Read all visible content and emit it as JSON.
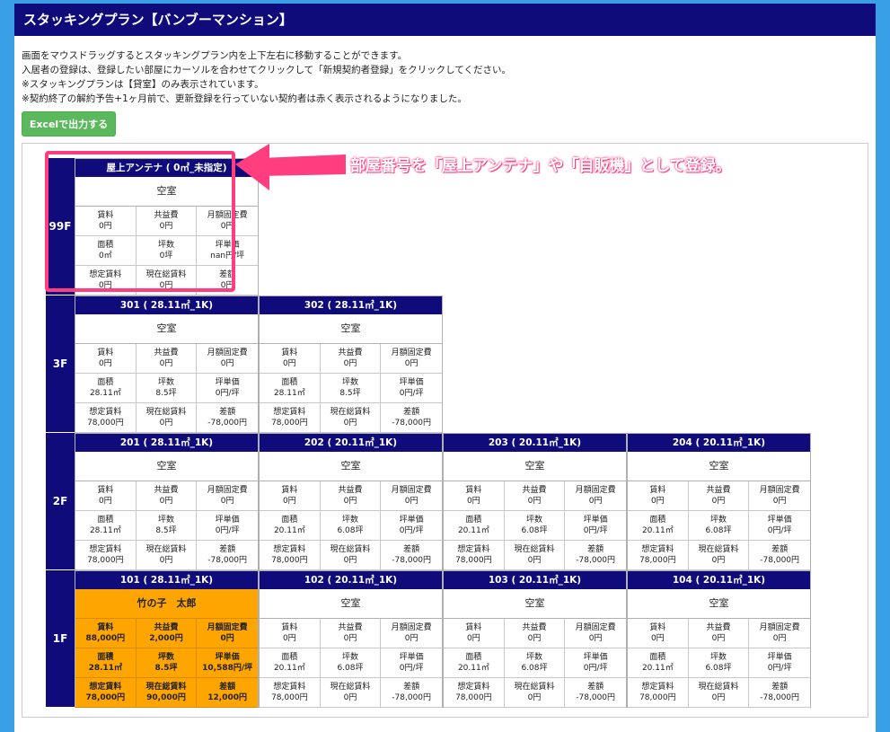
{
  "title": "スタッキングプラン【バンブーマンション】",
  "notes": [
    "画面をマウスドラッグするとスタッキングプラン内を上下左右に移動することができます。",
    "入居者の登録は、登録したい部屋にカーソルを合わせてクリックして「新規契約者登録」をクリックしてください。",
    "※スタッキングプランは【貸室】のみ表示されています。",
    "※契約終了の解約予告+1ヶ月前で、更新登録を行っていない契約者は赤く表示されるようになりました。"
  ],
  "excel_button": "Excelで出力する",
  "annotation": "部屋番号を「屋上アンテナ」や「自販機」として登録。",
  "colors": {
    "header": "#0f0b7a",
    "occupied": "#ffa500",
    "annotation": "#ff3d7f",
    "excel": "#5cb85c"
  },
  "floors": [
    {
      "label": "99F",
      "rooms": [
        {
          "name": "屋上アンテナ ( 0㎡_未指定)",
          "tenant": "空室",
          "occupied": false,
          "cells": [
            [
              "賃料",
              "0円"
            ],
            [
              "共益費",
              "0円"
            ],
            [
              "月額固定費",
              "0円"
            ],
            [
              "面積",
              "0㎡"
            ],
            [
              "坪数",
              "0坪"
            ],
            [
              "坪単価",
              "nan円/坪"
            ],
            [
              "想定賃料",
              "0円"
            ],
            [
              "現在総賃料",
              "0円"
            ],
            [
              "差額",
              "0円"
            ]
          ]
        }
      ]
    },
    {
      "label": "3F",
      "rooms": [
        {
          "name": "301 ( 28.11㎡_1K)",
          "tenant": "空室",
          "occupied": false,
          "cells": [
            [
              "賃料",
              "0円"
            ],
            [
              "共益費",
              "0円"
            ],
            [
              "月額固定費",
              "0円"
            ],
            [
              "面積",
              "28.11㎡"
            ],
            [
              "坪数",
              "8.5坪"
            ],
            [
              "坪単価",
              "0円/坪"
            ],
            [
              "想定賃料",
              "78,000円"
            ],
            [
              "現在総賃料",
              "0円"
            ],
            [
              "差額",
              "-78,000円"
            ]
          ]
        },
        {
          "name": "302 ( 28.11㎡_1K)",
          "tenant": "空室",
          "occupied": false,
          "cells": [
            [
              "賃料",
              "0円"
            ],
            [
              "共益費",
              "0円"
            ],
            [
              "月額固定費",
              "0円"
            ],
            [
              "面積",
              "28.11㎡"
            ],
            [
              "坪数",
              "8.5坪"
            ],
            [
              "坪単価",
              "0円/坪"
            ],
            [
              "想定賃料",
              "78,000円"
            ],
            [
              "現在総賃料",
              "0円"
            ],
            [
              "差額",
              "-78,000円"
            ]
          ]
        }
      ]
    },
    {
      "label": "2F",
      "rooms": [
        {
          "name": "201 ( 28.11㎡_1K)",
          "tenant": "空室",
          "occupied": false,
          "cells": [
            [
              "賃料",
              "0円"
            ],
            [
              "共益費",
              "0円"
            ],
            [
              "月額固定費",
              "0円"
            ],
            [
              "面積",
              "28.11㎡"
            ],
            [
              "坪数",
              "8.5坪"
            ],
            [
              "坪単価",
              "0円/坪"
            ],
            [
              "想定賃料",
              "78,000円"
            ],
            [
              "現在総賃料",
              "0円"
            ],
            [
              "差額",
              "-78,000円"
            ]
          ]
        },
        {
          "name": "202 ( 20.11㎡_1K)",
          "tenant": "空室",
          "occupied": false,
          "cells": [
            [
              "賃料",
              "0円"
            ],
            [
              "共益費",
              "0円"
            ],
            [
              "月額固定費",
              "0円"
            ],
            [
              "面積",
              "20.11㎡"
            ],
            [
              "坪数",
              "6.08坪"
            ],
            [
              "坪単価",
              "0円/坪"
            ],
            [
              "想定賃料",
              "78,000円"
            ],
            [
              "現在総賃料",
              "0円"
            ],
            [
              "差額",
              "-78,000円"
            ]
          ]
        },
        {
          "name": "203 ( 20.11㎡_1K)",
          "tenant": "空室",
          "occupied": false,
          "cells": [
            [
              "賃料",
              "0円"
            ],
            [
              "共益費",
              "0円"
            ],
            [
              "月額固定費",
              "0円"
            ],
            [
              "面積",
              "20.11㎡"
            ],
            [
              "坪数",
              "6.08坪"
            ],
            [
              "坪単価",
              "0円/坪"
            ],
            [
              "想定賃料",
              "78,000円"
            ],
            [
              "現在総賃料",
              "0円"
            ],
            [
              "差額",
              "-78,000円"
            ]
          ]
        },
        {
          "name": "204 ( 20.11㎡_1K)",
          "tenant": "空室",
          "occupied": false,
          "cells": [
            [
              "賃料",
              "0円"
            ],
            [
              "共益費",
              "0円"
            ],
            [
              "月額固定費",
              "0円"
            ],
            [
              "面積",
              "20.11㎡"
            ],
            [
              "坪数",
              "6.08坪"
            ],
            [
              "坪単価",
              "0円/坪"
            ],
            [
              "想定賃料",
              "78,000円"
            ],
            [
              "現在総賃料",
              "0円"
            ],
            [
              "差額",
              "-78,000円"
            ]
          ]
        }
      ]
    },
    {
      "label": "1F",
      "rooms": [
        {
          "name": "101 ( 28.11㎡_1K)",
          "tenant": "竹の子　太郎",
          "occupied": true,
          "cells": [
            [
              "賃料",
              "88,000円"
            ],
            [
              "共益費",
              "2,000円"
            ],
            [
              "月額固定費",
              "0円"
            ],
            [
              "面積",
              "28.11㎡"
            ],
            [
              "坪数",
              "8.5坪"
            ],
            [
              "坪単価",
              "10,588円/坪"
            ],
            [
              "想定賃料",
              "78,000円"
            ],
            [
              "現在総賃料",
              "90,000円"
            ],
            [
              "差額",
              "12,000円"
            ]
          ]
        },
        {
          "name": "102 ( 20.11㎡_1K)",
          "tenant": "空室",
          "occupied": false,
          "cells": [
            [
              "賃料",
              "0円"
            ],
            [
              "共益費",
              "0円"
            ],
            [
              "月額固定費",
              "0円"
            ],
            [
              "面積",
              "20.11㎡"
            ],
            [
              "坪数",
              "6.08坪"
            ],
            [
              "坪単価",
              "0円/坪"
            ],
            [
              "想定賃料",
              "78,000円"
            ],
            [
              "現在総賃料",
              "0円"
            ],
            [
              "差額",
              "-78,000円"
            ]
          ]
        },
        {
          "name": "103 ( 20.11㎡_1K)",
          "tenant": "空室",
          "occupied": false,
          "cells": [
            [
              "賃料",
              "0円"
            ],
            [
              "共益費",
              "0円"
            ],
            [
              "月額固定費",
              "0円"
            ],
            [
              "面積",
              "20.11㎡"
            ],
            [
              "坪数",
              "6.08坪"
            ],
            [
              "坪単価",
              "0円/坪"
            ],
            [
              "想定賃料",
              "78,000円"
            ],
            [
              "現在総賃料",
              "0円"
            ],
            [
              "差額",
              "-78,000円"
            ]
          ]
        },
        {
          "name": "104 ( 20.11㎡_1K)",
          "tenant": "空室",
          "occupied": false,
          "cells": [
            [
              "賃料",
              "0円"
            ],
            [
              "共益費",
              "0円"
            ],
            [
              "月額固定費",
              "0円"
            ],
            [
              "面積",
              "20.11㎡"
            ],
            [
              "坪数",
              "6.08坪"
            ],
            [
              "坪単価",
              "0円/坪"
            ],
            [
              "想定賃料",
              "78,000円"
            ],
            [
              "現在総賃料",
              "0円"
            ],
            [
              "差額",
              "-78,000円"
            ]
          ]
        }
      ]
    }
  ]
}
